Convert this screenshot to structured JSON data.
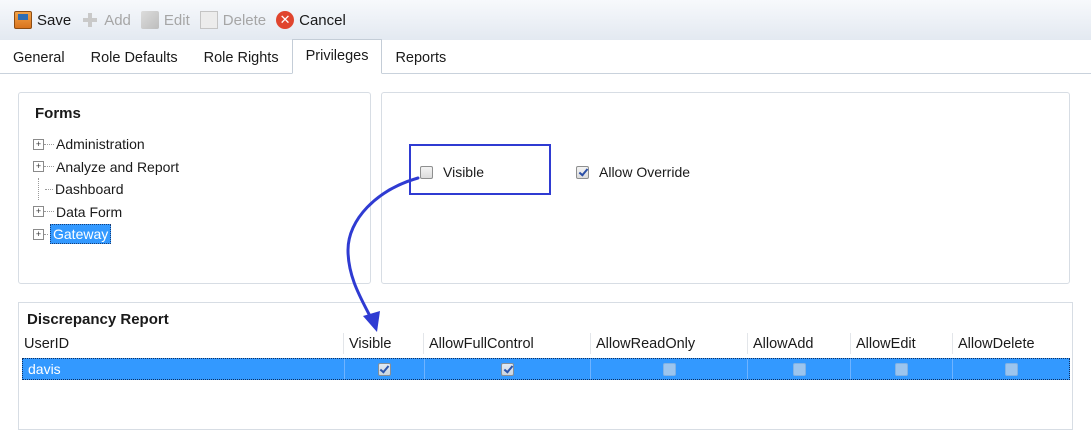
{
  "toolbar": {
    "save_label": "Save",
    "add_label": "Add",
    "edit_label": "Edit",
    "delete_label": "Delete",
    "cancel_label": "Cancel",
    "cancel_glyph": "✕"
  },
  "tabs": [
    {
      "label": "General"
    },
    {
      "label": "Role Defaults"
    },
    {
      "label": "Role Rights"
    },
    {
      "label": "Privileges",
      "active": true
    },
    {
      "label": "Reports"
    }
  ],
  "forms": {
    "title": "Forms",
    "tree": [
      {
        "label": "Administration",
        "expander": "+"
      },
      {
        "label": "Analyze and Report",
        "expander": "+"
      },
      {
        "label": "Dashboard",
        "expander": ""
      },
      {
        "label": "Data Form",
        "expander": "+"
      },
      {
        "label": "Gateway",
        "expander": "+",
        "selected": true
      }
    ]
  },
  "settings": {
    "visible_label": "Visible",
    "visible_checked": false,
    "allow_override_label": "Allow Override",
    "allow_override_checked": true
  },
  "discrepancy": {
    "title": "Discrepancy Report",
    "columns": [
      "UserID",
      "Visible",
      "AllowFullControl",
      "AllowReadOnly",
      "AllowAdd",
      "AllowEdit",
      "AllowDelete"
    ],
    "rows": [
      {
        "user": "davis",
        "visible": true,
        "allow_full_control": true,
        "allow_read_only": false,
        "allow_add": false,
        "allow_edit": false,
        "allow_delete": false
      }
    ]
  },
  "colors": {
    "selection": "#3399ff",
    "annotation": "#2f3bd2"
  }
}
